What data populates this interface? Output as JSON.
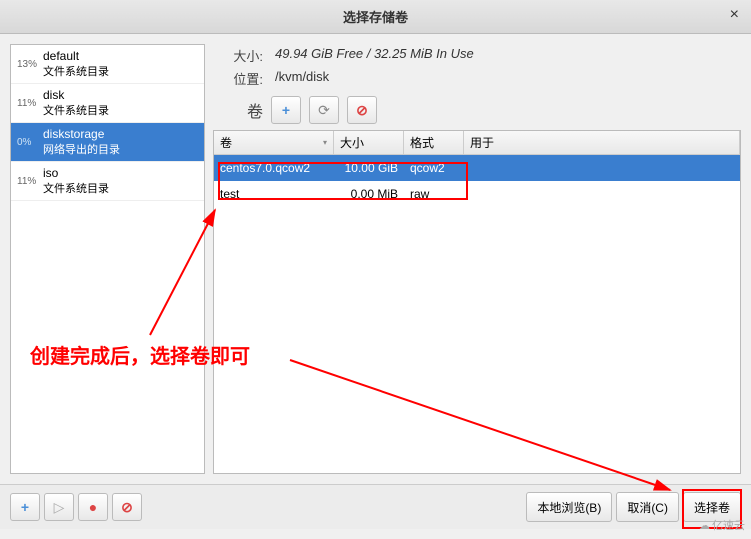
{
  "title": "选择存储卷",
  "pools": [
    {
      "pct": "13%",
      "name": "default",
      "sub": "文件系统目录"
    },
    {
      "pct": "11%",
      "name": "disk",
      "sub": "文件系统目录"
    },
    {
      "pct": "0%",
      "name": "diskstorage",
      "sub": "网络导出的目录"
    },
    {
      "pct": "11%",
      "name": "iso",
      "sub": "文件系统目录"
    }
  ],
  "info": {
    "size_label": "大小:",
    "size_value": "49.94 GiB Free / 32.25 MiB In Use",
    "loc_label": "位置:",
    "loc_value": "/kvm/disk",
    "vol_label": "卷"
  },
  "columns": {
    "c1": "卷",
    "c2": "大小",
    "c3": "格式",
    "c4": "用于"
  },
  "rows": [
    {
      "name": "centos7.0.qcow2",
      "size": "10.00 GiB",
      "fmt": "qcow2",
      "used": ""
    },
    {
      "name": "test",
      "size": "0.00 MiB",
      "fmt": "raw",
      "used": ""
    }
  ],
  "buttons": {
    "browse": "本地浏览(B)",
    "cancel": "取消(C)",
    "choose": "选择卷"
  },
  "annotation": "创建完成后，选择卷即可",
  "watermark": "亿速云"
}
